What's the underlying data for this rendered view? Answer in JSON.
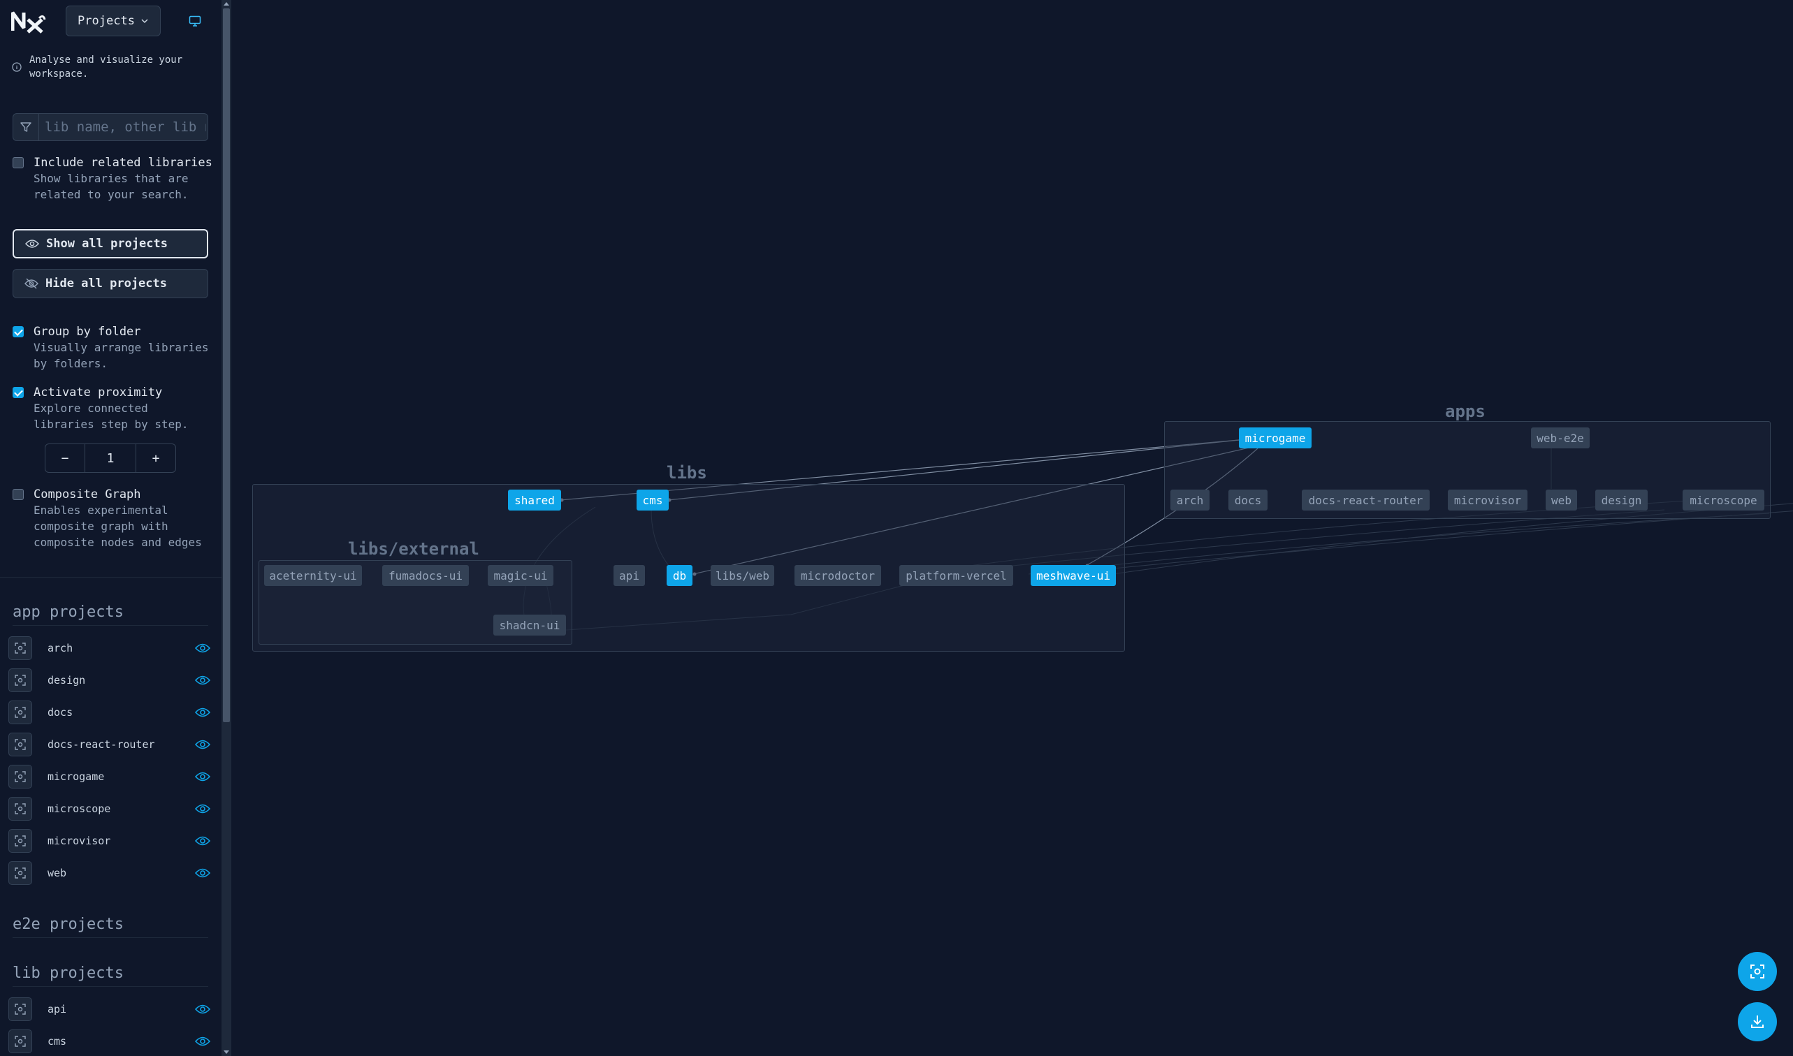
{
  "header": {
    "logo_text": "Nx",
    "project_select": "Projects"
  },
  "info": "Analyse and visualize your workspace.",
  "search": {
    "placeholder": "lib name, other lib name"
  },
  "options": {
    "include_related": {
      "title": "Include related libraries",
      "desc": "Show libraries that are related to your search.",
      "checked": false
    },
    "show_all_label": "Show all projects",
    "hide_all_label": "Hide all projects",
    "group_by_folder": {
      "title": "Group by folder",
      "desc": "Visually arrange libraries by folders.",
      "checked": true
    },
    "proximity": {
      "title": "Activate proximity",
      "desc": "Explore connected libraries step by step.",
      "checked": true,
      "value": "1",
      "minus": "−",
      "plus": "+"
    },
    "composite": {
      "title": "Composite Graph",
      "desc": "Enables experimental composite graph with composite nodes and edges",
      "checked": false
    }
  },
  "sections": {
    "app_title": "app projects",
    "app_projects": [
      "arch",
      "design",
      "docs",
      "docs-react-router",
      "microgame",
      "microscope",
      "microvisor",
      "web"
    ],
    "e2e_title": "e2e projects",
    "lib_title": "lib projects",
    "lib_projects": [
      "api",
      "cms"
    ]
  },
  "graph": {
    "groups": {
      "apps": "apps",
      "libs": "libs",
      "external": "libs/external"
    },
    "nodes": {
      "microgame": "microgame",
      "web_e2e": "web-e2e",
      "arch": "arch",
      "docs": "docs",
      "docs_react_router": "docs-react-router",
      "microvisor": "microvisor",
      "web": "web",
      "design": "design",
      "microscope": "microscope",
      "shared": "shared",
      "cms": "cms",
      "aceternity_ui": "aceternity-ui",
      "fumadocs_ui": "fumadocs-ui",
      "magic_ui": "magic-ui",
      "shadcn_ui": "shadcn-ui",
      "api": "api",
      "db": "db",
      "libs_web": "libs/web",
      "microdoctor": "microdoctor",
      "platform_vercel": "platform-vercel",
      "meshwave_ui": "meshwave-ui"
    },
    "highlighted": [
      "microgame",
      "shared",
      "cms",
      "db",
      "meshwave-ui"
    ]
  },
  "colors": {
    "background": "#0f172a",
    "accent": "#0ea5e9",
    "node": "#334155",
    "panel": "#1e293b"
  },
  "icons": [
    "nx-logo-icon",
    "chevron-down-icon",
    "monitor-icon",
    "info-icon",
    "filter-icon",
    "eye-icon",
    "eye-off-icon",
    "focus-icon",
    "fit-view-icon",
    "download-icon"
  ]
}
